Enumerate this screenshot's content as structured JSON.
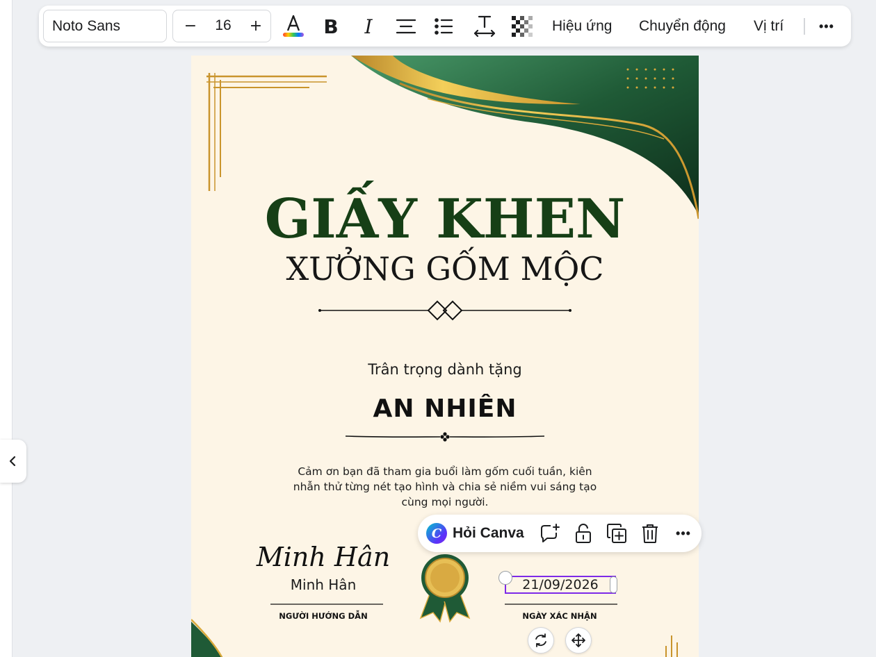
{
  "toolbar": {
    "font_family": "Noto Sans",
    "font_size": "16",
    "decrease_label": "−",
    "increase_label": "+",
    "bold_label": "B",
    "italic_label": "I",
    "effects_label": "Hiệu ứng",
    "animate_label": "Chuyển động",
    "position_label": "Vị trí",
    "more_label": "•••"
  },
  "certificate": {
    "title": "GIẤY KHEN",
    "subtitle": "XƯỞNG GỐM MỘC",
    "dedication": "Trân trọng dành tặng",
    "recipient": "AN NHIÊN",
    "message": "Cảm ơn bạn đã tham gia buổi làm gốm cuối tuần, kiên nhẫn thử từng nét tạo hình và chia sẻ niềm vui sáng tạo cùng mọi người.",
    "signature_script": "Minh Hân",
    "signature_name": "Minh Hân",
    "signature_role": "NGƯỜI HƯỚNG DẪN",
    "date": "21/09/2026",
    "date_role": "NGÀY XÁC NHẬN"
  },
  "context_menu": {
    "logo_letter": "C",
    "ask_label": "Hỏi Canva",
    "more_label": "•••"
  },
  "colors": {
    "accent": "#7d2ae8",
    "title_green": "#163f16",
    "gold": "#c9942c",
    "background": "#fdf5e6"
  },
  "icons": {
    "collapse": "chevron-left-icon",
    "text_color": "text-color-icon",
    "align": "align-center-icon",
    "list": "bullet-list-icon",
    "spacing": "letter-spacing-icon",
    "transparency": "transparency-icon",
    "comment": "add-comment-icon",
    "lock": "lock-icon",
    "duplicate": "duplicate-icon",
    "delete": "trash-icon",
    "rotate": "rotate-icon",
    "move": "move-icon"
  }
}
